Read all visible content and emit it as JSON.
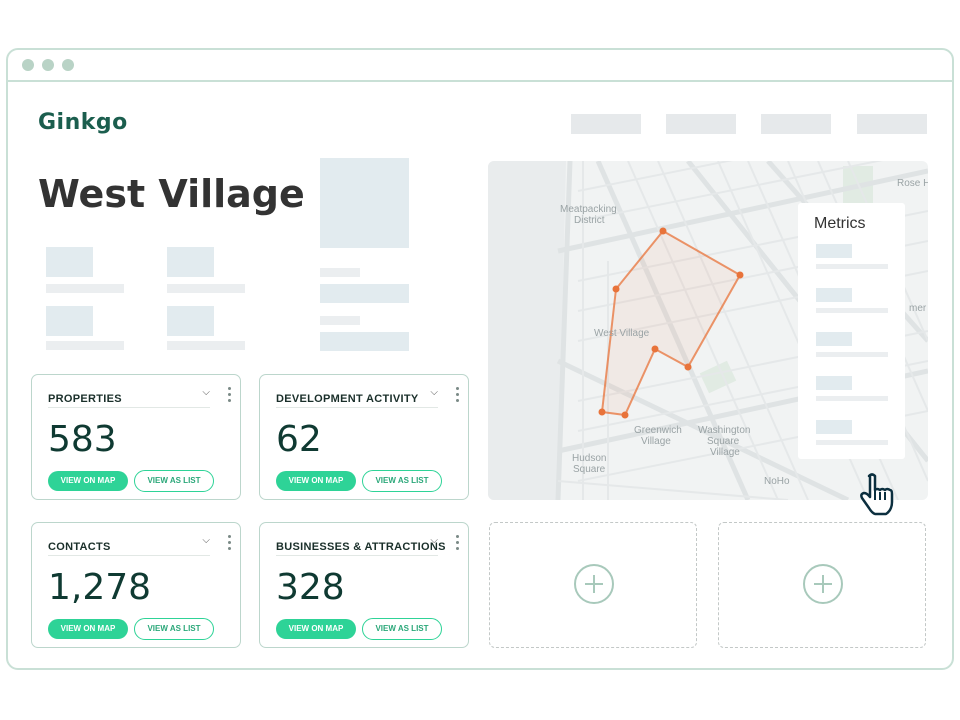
{
  "brand": {
    "name": "Ginkgo"
  },
  "page": {
    "title": "West Village"
  },
  "cards": [
    {
      "label": "PROPERTIES",
      "value": "583",
      "map_btn": "VIEW ON MAP",
      "list_btn": "VIEW AS LIST"
    },
    {
      "label": "DEVELOPMENT ACTIVITY",
      "value": "62",
      "map_btn": "VIEW ON MAP",
      "list_btn": "VIEW AS LIST"
    },
    {
      "label": "CONTACTS",
      "value": "1,278",
      "map_btn": "VIEW ON MAP",
      "list_btn": "VIEW AS LIST"
    },
    {
      "label": "BUSINESSES & ATTRACTIONS",
      "value": "328",
      "map_btn": "VIEW ON MAP",
      "list_btn": "VIEW AS LIST"
    }
  ],
  "map": {
    "labels": {
      "meatpacking_1": "Meatpacking",
      "meatpacking_2": "District",
      "west_village": "West Village",
      "greenwich_1": "Greenwich",
      "greenwich_2": "Village",
      "washington_1": "Washington",
      "washington_2": "Square",
      "washington_3": "Village",
      "hudson_1": "Hudson",
      "hudson_2": "Square",
      "noho": "NoHo",
      "rose_hill": "Rose H",
      "gramercy": "mer"
    },
    "metrics_title": "Metrics"
  },
  "colors": {
    "accent": "#2ed397",
    "brand": "#1b5e4e",
    "polygon": "#e8733a"
  }
}
